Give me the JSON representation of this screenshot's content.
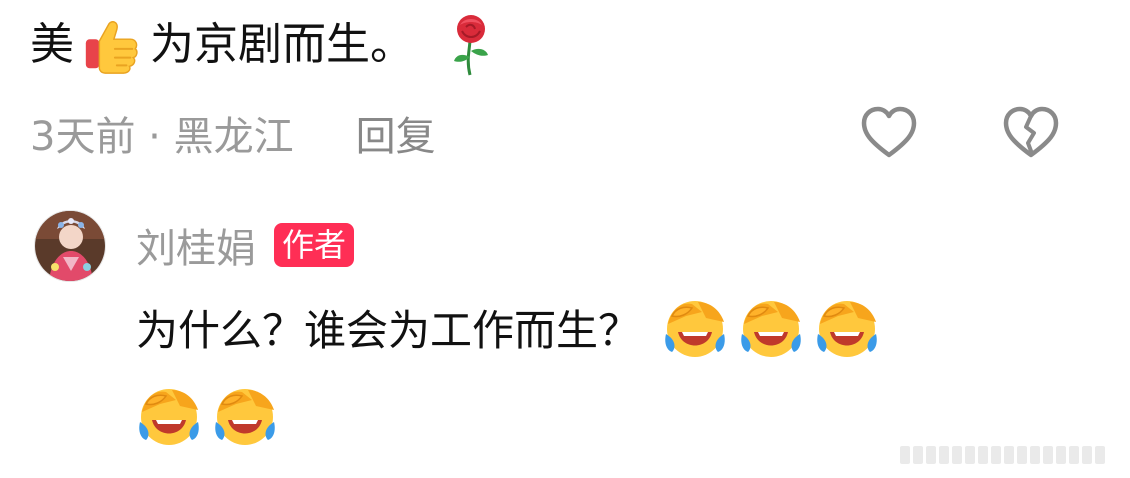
{
  "comment": {
    "text_before": "美",
    "thumb_icon": "thumbs-up-icon",
    "text_after": "为京剧而生。",
    "rose_icon": "rose-icon",
    "meta": "3天前 · 黑龙江",
    "reply_label": "回复",
    "like_icon": "heart-outline-icon",
    "dislike_icon": "broken-heart-icon"
  },
  "reply": {
    "username": "刘桂娟",
    "badge": "作者",
    "badge_color": "#ff2e55",
    "text": "为什么？谁会为工作而生？",
    "emoji_icon": "laughing-crying-face-icon",
    "emoji_count_line1": 3,
    "emoji_count_line2": 2
  },
  "colors": {
    "primary_text": "#111111",
    "secondary_text": "#9a9a9a"
  }
}
